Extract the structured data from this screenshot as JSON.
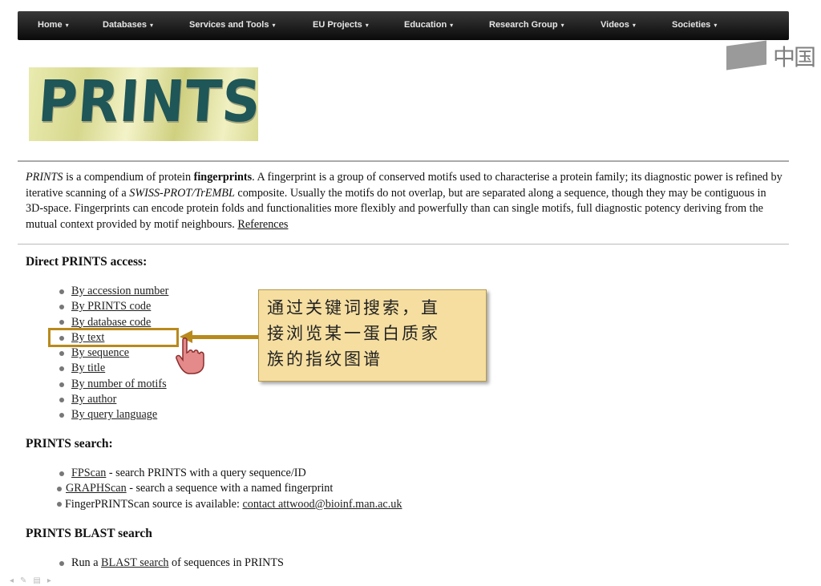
{
  "nav": {
    "items": [
      {
        "label": "Home"
      },
      {
        "label": "Databases"
      },
      {
        "label": "Services and Tools"
      },
      {
        "label": "EU Projects"
      },
      {
        "label": "Education"
      },
      {
        "label": "Research Group"
      },
      {
        "label": "Videos"
      },
      {
        "label": "Societies"
      }
    ],
    "caret": "▾"
  },
  "corner_logo": {
    "text": "中国"
  },
  "logo": {
    "text": "PRINTS"
  },
  "intro": {
    "prints": "PRINTS",
    "t1": " is a compendium of protein ",
    "fingerprints": "fingerprints",
    "t2": ". A fingerprint is a group of conserved motifs used to characterise a protein family; its diagnostic power is refined by iterative scanning of a ",
    "swiss": "SWISS-PROT/TrEMBL",
    "t3": " composite. Usually the motifs do not overlap, but are separated along a sequence, though they may be contiguous in 3D-space. Fingerprints can encode protein folds and functionalities more flexibly and powerfully than can single motifs, full diagnostic potency deriving from the mutual context provided by motif neighbours. ",
    "references": "References"
  },
  "direct": {
    "heading": "Direct PRINTS access:",
    "links": [
      {
        "label": "By accession number"
      },
      {
        "label": "By PRINTS code"
      },
      {
        "label": "By database code"
      },
      {
        "label": "By text"
      },
      {
        "label": "By sequence"
      },
      {
        "label": "By title"
      },
      {
        "label": "By number of motifs"
      },
      {
        "label": "By author"
      },
      {
        "label": "By query language"
      }
    ]
  },
  "search": {
    "heading": "PRINTS search:",
    "fpscan_link": "FPScan",
    "fpscan_text": " - search PRINTS with a query sequence/ID",
    "graphscan_link": "GRAPHScan",
    "graphscan_text": " - search a sequence with a named fingerprint",
    "source_text": "FingerPRINTScan source is available: ",
    "contact_link": "contact attwood@bioinf.man.ac.uk"
  },
  "blast": {
    "heading": "PRINTS BLAST search",
    "run_text": "Run a ",
    "blast_link": "BLAST search",
    "tail_text": " of sequences in PRINTS"
  },
  "callout": {
    "line1": "通过关键词搜索，直",
    "line2": "接浏览某一蛋白质家",
    "line3": "族的指纹图谱"
  },
  "colors": {
    "accent": "#b88a1c",
    "callout_bg": "#f5dea0",
    "nav_bg": "#111111",
    "logo_text": "#1f5658"
  }
}
